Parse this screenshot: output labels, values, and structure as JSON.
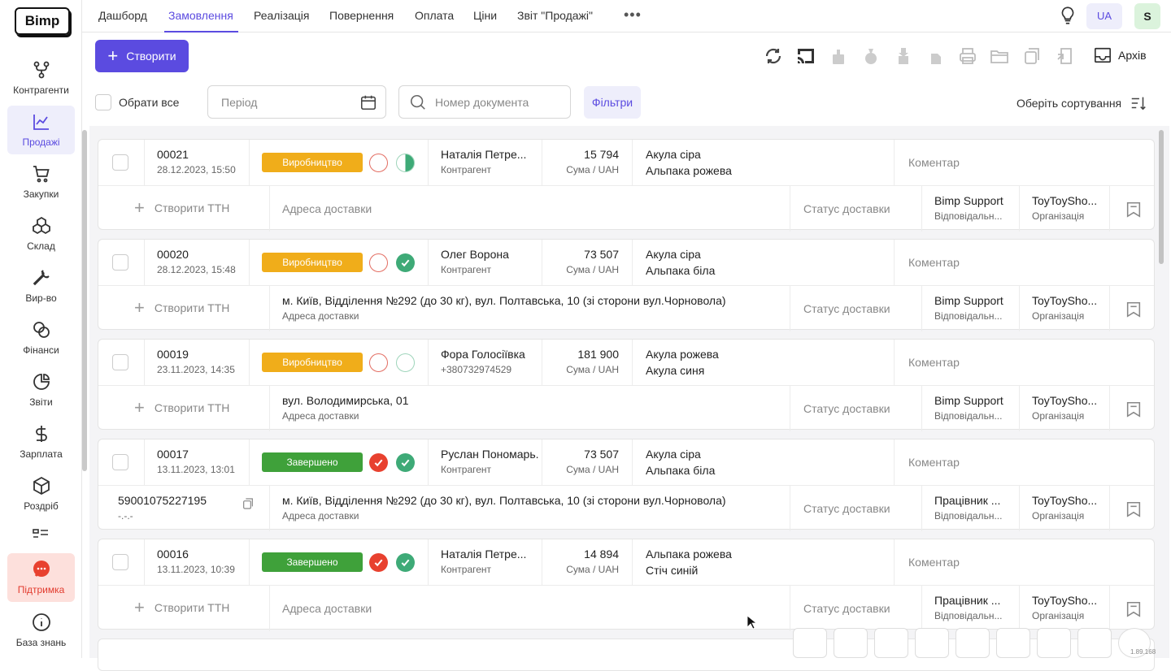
{
  "sidebar": {
    "logo": "Bimp",
    "items": [
      {
        "label": "Контрагенти",
        "icon": "branch-icon"
      },
      {
        "label": "Продажі",
        "icon": "chart-icon"
      },
      {
        "label": "Закупки",
        "icon": "cart-icon"
      },
      {
        "label": "Склад",
        "icon": "boxes-icon"
      },
      {
        "label": "Вир-во",
        "icon": "wrench-icon"
      },
      {
        "label": "Фінанси",
        "icon": "coins-icon"
      },
      {
        "label": "Звіти",
        "icon": "pie-chart-icon"
      },
      {
        "label": "Зарплата",
        "icon": "dollar-icon"
      },
      {
        "label": "Роздріб",
        "icon": "cube-icon"
      },
      {
        "label": "Підтримка",
        "icon": "chat-icon"
      },
      {
        "label": "База знань",
        "icon": "info-icon"
      }
    ]
  },
  "tabs": [
    "Дашборд",
    "Замовлення",
    "Реалізація",
    "Повернення",
    "Оплата",
    "Ціни",
    "Звіт \"Продажі\""
  ],
  "active_tab": "Замовлення",
  "header": {
    "lang": "UA",
    "avatar": "S"
  },
  "toolbar": {
    "create_label": "Створити",
    "archive_label": "Архів"
  },
  "filters": {
    "select_all": "Обрати все",
    "period_placeholder": "Період",
    "docnum_placeholder": "Номер документа",
    "filters_label": "Фільтри",
    "sort_label": "Оберіть сортування"
  },
  "orders": [
    {
      "number": "00021",
      "date": "28.12.2023, 15:50",
      "status": "Виробництво",
      "contractor": "Наталія Петре...",
      "contractor_sub": "Контрагент",
      "sum": "15 794",
      "sum_sub": "Сума / UAH",
      "item1": "Акула сіра",
      "item2": "Альпака рожева",
      "comment": "Коментар",
      "ttn": "Створити ТТН",
      "ttn_sub": "",
      "address": "Адреса доставки",
      "address_sub": "",
      "delivery_status": "Статус доставки",
      "responsible": "Bimp Support",
      "responsible_sub": "Відповідальн...",
      "org": "ToyToySho...",
      "org_sub": "Організація"
    },
    {
      "number": "00020",
      "date": "28.12.2023, 15:48",
      "status": "Виробництво",
      "contractor": "Олег Ворона",
      "contractor_sub": "Контрагент",
      "sum": "73 507",
      "sum_sub": "Сума / UAH",
      "item1": "Акула сіра",
      "item2": "Альпака біла",
      "comment": "Коментар",
      "ttn": "Створити ТТН",
      "ttn_sub": "",
      "address": "м. Київ, Відділення №292 (до 30 кг), вул. Полтавська, 10 (зі сторони вул.Чорновола)",
      "address_sub": "Адреса доставки",
      "delivery_status": "Статус доставки",
      "responsible": "Bimp Support",
      "responsible_sub": "Відповідальн...",
      "org": "ToyToySho...",
      "org_sub": "Організація"
    },
    {
      "number": "00019",
      "date": "23.11.2023, 14:35",
      "status": "Виробництво",
      "contractor": "Фора Голосіївка",
      "contractor_sub": "+380732974529",
      "sum": "181 900",
      "sum_sub": "Сума / UAH",
      "item1": "Акула рожева",
      "item2": "Акула синя",
      "comment": "Коментар",
      "ttn": "Створити ТТН",
      "ttn_sub": "",
      "address": "вул. Володимирська, 01",
      "address_sub": "Адреса доставки",
      "delivery_status": "Статус доставки",
      "responsible": "Bimp Support",
      "responsible_sub": "Відповідальн...",
      "org": "ToyToySho...",
      "org_sub": "Організація"
    },
    {
      "number": "00017",
      "date": "13.11.2023, 13:01",
      "status": "Завершено",
      "contractor": "Руслан Пономарь...",
      "contractor_sub": "Контрагент",
      "sum": "73 507",
      "sum_sub": "Сума / UAH",
      "item1": "Акула сіра",
      "item2": "Альпака біла",
      "comment": "Коментар",
      "ttn": "59001075227195",
      "ttn_sub": "-.-.-",
      "address": "м. Київ, Відділення №292 (до 30 кг), вул. Полтавська, 10 (зі сторони вул.Чорновола)",
      "address_sub": "Адреса доставки",
      "delivery_status": "Статус доставки",
      "responsible": "Працівник ...",
      "responsible_sub": "Відповідальн...",
      "org": "ToyToySho...",
      "org_sub": "Організація"
    },
    {
      "number": "00016",
      "date": "13.11.2023, 10:39",
      "status": "Завершено",
      "contractor": "Наталія Петре...",
      "contractor_sub": "Контрагент",
      "sum": "14 894",
      "sum_sub": "Сума / UAH",
      "item1": "Альпака рожева",
      "item2": "Стіч синій",
      "comment": "Коментар",
      "ttn": "Створити ТТН",
      "ttn_sub": "",
      "address": "Адреса доставки",
      "address_sub": "",
      "delivery_status": "Статус доставки",
      "responsible": "Працівник ...",
      "responsible_sub": "Відповідальн...",
      "org": "ToyToySho...",
      "org_sub": "Організація"
    }
  ],
  "version": "1.89.168",
  "colors": {
    "accent": "#5b4be0",
    "production": "#f0ad1a",
    "done": "#3fa13a"
  }
}
